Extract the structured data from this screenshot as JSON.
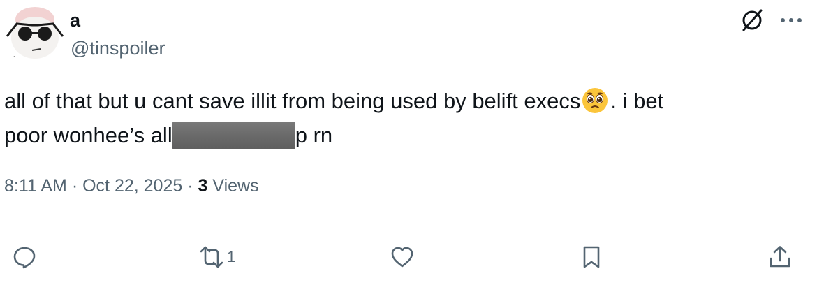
{
  "author": {
    "display_name": "a",
    "handle": "@tinspoiler",
    "avatar_icon": "avatar-sunglasses-character"
  },
  "header_icons": [
    "grok-icon",
    "more-icon"
  ],
  "tweet": {
    "text_part1": "all of that but u cant save illit from being used by belift execs",
    "emoji": "pleading-face-emoji",
    "text_part2": ". i bet",
    "text_part3": "poor wonhee’s all",
    "redacted": "redacted-text",
    "text_part4": "p rn"
  },
  "meta": {
    "time": "8:11 AM",
    "separator": "·",
    "date": "Oct 22, 2025",
    "views_count": "3",
    "views_label": "Views"
  },
  "actions": {
    "reply": {
      "icon": "reply-icon",
      "count": ""
    },
    "retweet": {
      "icon": "retweet-icon",
      "count": "1"
    },
    "like": {
      "icon": "heart-icon",
      "count": ""
    },
    "bookmark": {
      "icon": "bookmark-icon",
      "count": ""
    },
    "share": {
      "icon": "share-icon",
      "count": ""
    }
  },
  "colors": {
    "text_primary": "#0f1419",
    "text_secondary": "#536471",
    "divider": "#eff3f4",
    "redaction": "#6a6a6a"
  }
}
